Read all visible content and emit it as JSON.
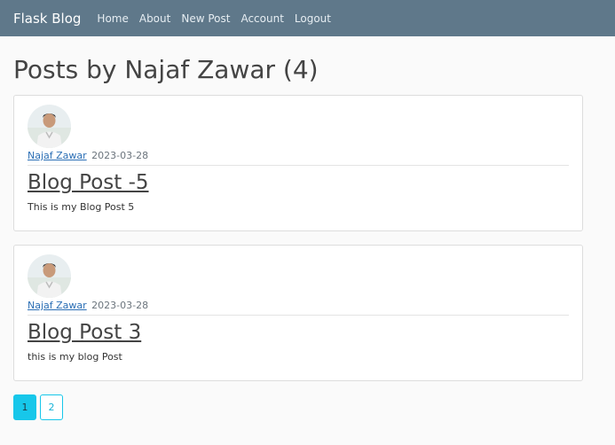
{
  "navbar": {
    "brand": "Flask Blog",
    "links": [
      {
        "label": "Home"
      },
      {
        "label": "About"
      },
      {
        "label": "New Post"
      },
      {
        "label": "Account"
      },
      {
        "label": "Logout"
      }
    ]
  },
  "page": {
    "title": "Posts by Najaf Zawar (4)"
  },
  "posts": [
    {
      "author": "Najaf Zawar",
      "date": "2023-03-28",
      "title": "Blog Post -5",
      "content": "This is my Blog Post 5"
    },
    {
      "author": "Najaf Zawar",
      "date": "2023-03-28",
      "title": "Blog Post 3",
      "content": "this is my blog Post"
    }
  ],
  "pagination": {
    "pages": [
      "1",
      "2"
    ],
    "active": "1"
  },
  "colors": {
    "navbar": "#5f788a",
    "background": "#fafafa",
    "link": "#2c6fb5",
    "page_active": "#17c7ea"
  },
  "icons": {
    "avatar": "profile-photo"
  }
}
